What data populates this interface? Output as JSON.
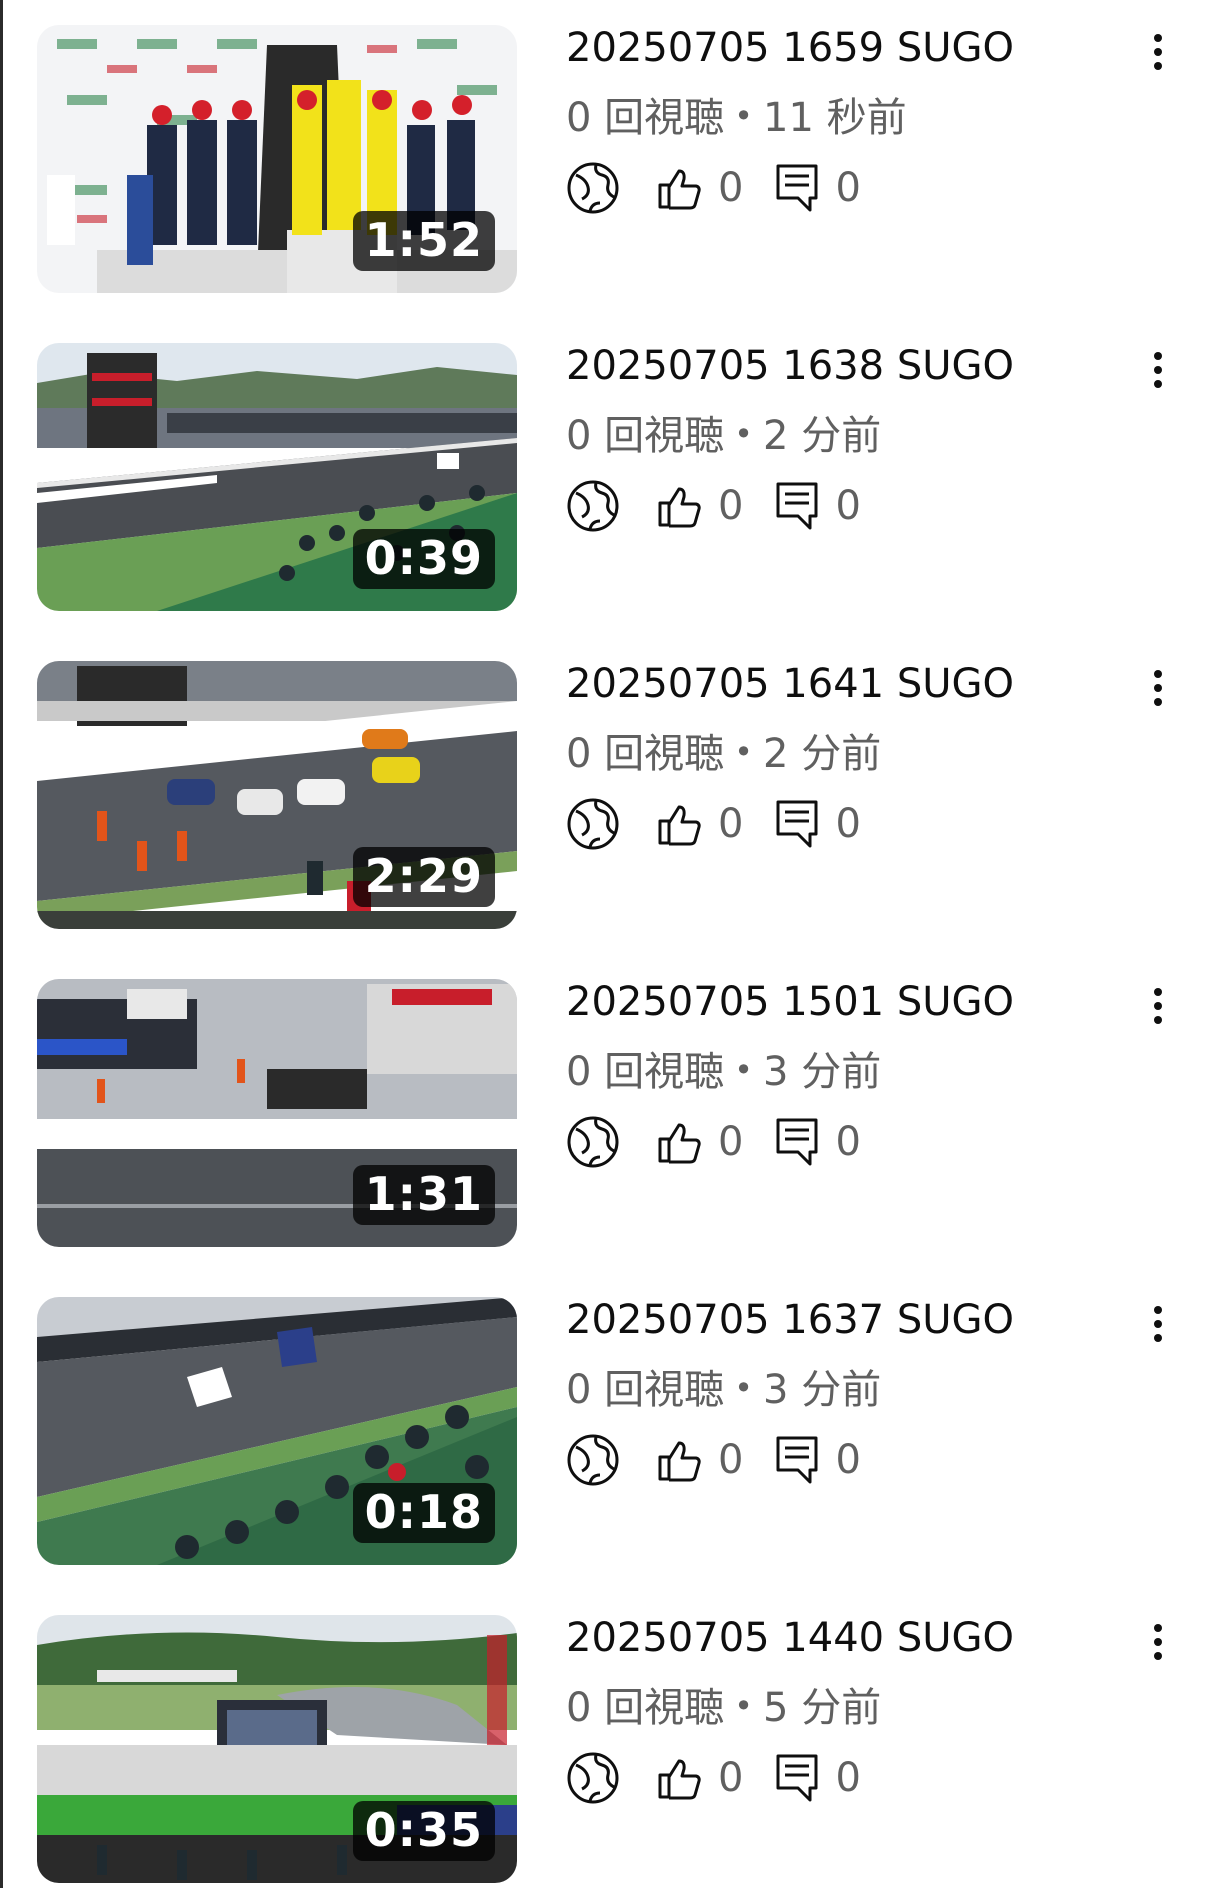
{
  "colors": {
    "text_primary": "#0f0f0f",
    "text_secondary": "#606060",
    "duration_bg": "#000000",
    "duration_text": "#ffffff"
  },
  "icons": {
    "visibility": "globe-icon",
    "likes": "thumbs-up-icon",
    "comments": "comment-icon",
    "menu": "more-vert-icon"
  },
  "videos": [
    {
      "title": "20250705 1659 SUGO",
      "views": "0 回視聴",
      "age": "11 秒前",
      "duration": "1:52",
      "likes": "0",
      "comments": "0"
    },
    {
      "title": "20250705 1638 SUGO",
      "views": "0 回視聴",
      "age": "2 分前",
      "duration": "0:39",
      "likes": "0",
      "comments": "0"
    },
    {
      "title": "20250705 1641 SUGO",
      "views": "0 回視聴",
      "age": "2 分前",
      "duration": "2:29",
      "likes": "0",
      "comments": "0"
    },
    {
      "title": "20250705 1501 SUGO",
      "views": "0 回視聴",
      "age": "3 分前",
      "duration": "1:31",
      "likes": "0",
      "comments": "0"
    },
    {
      "title": "20250705 1637 SUGO",
      "views": "0 回視聴",
      "age": "3 分前",
      "duration": "0:18",
      "likes": "0",
      "comments": "0"
    },
    {
      "title": "20250705 1440 SUGO",
      "views": "0 回視聴",
      "age": "5 分前",
      "duration": "0:35",
      "likes": "0",
      "comments": "0"
    }
  ]
}
